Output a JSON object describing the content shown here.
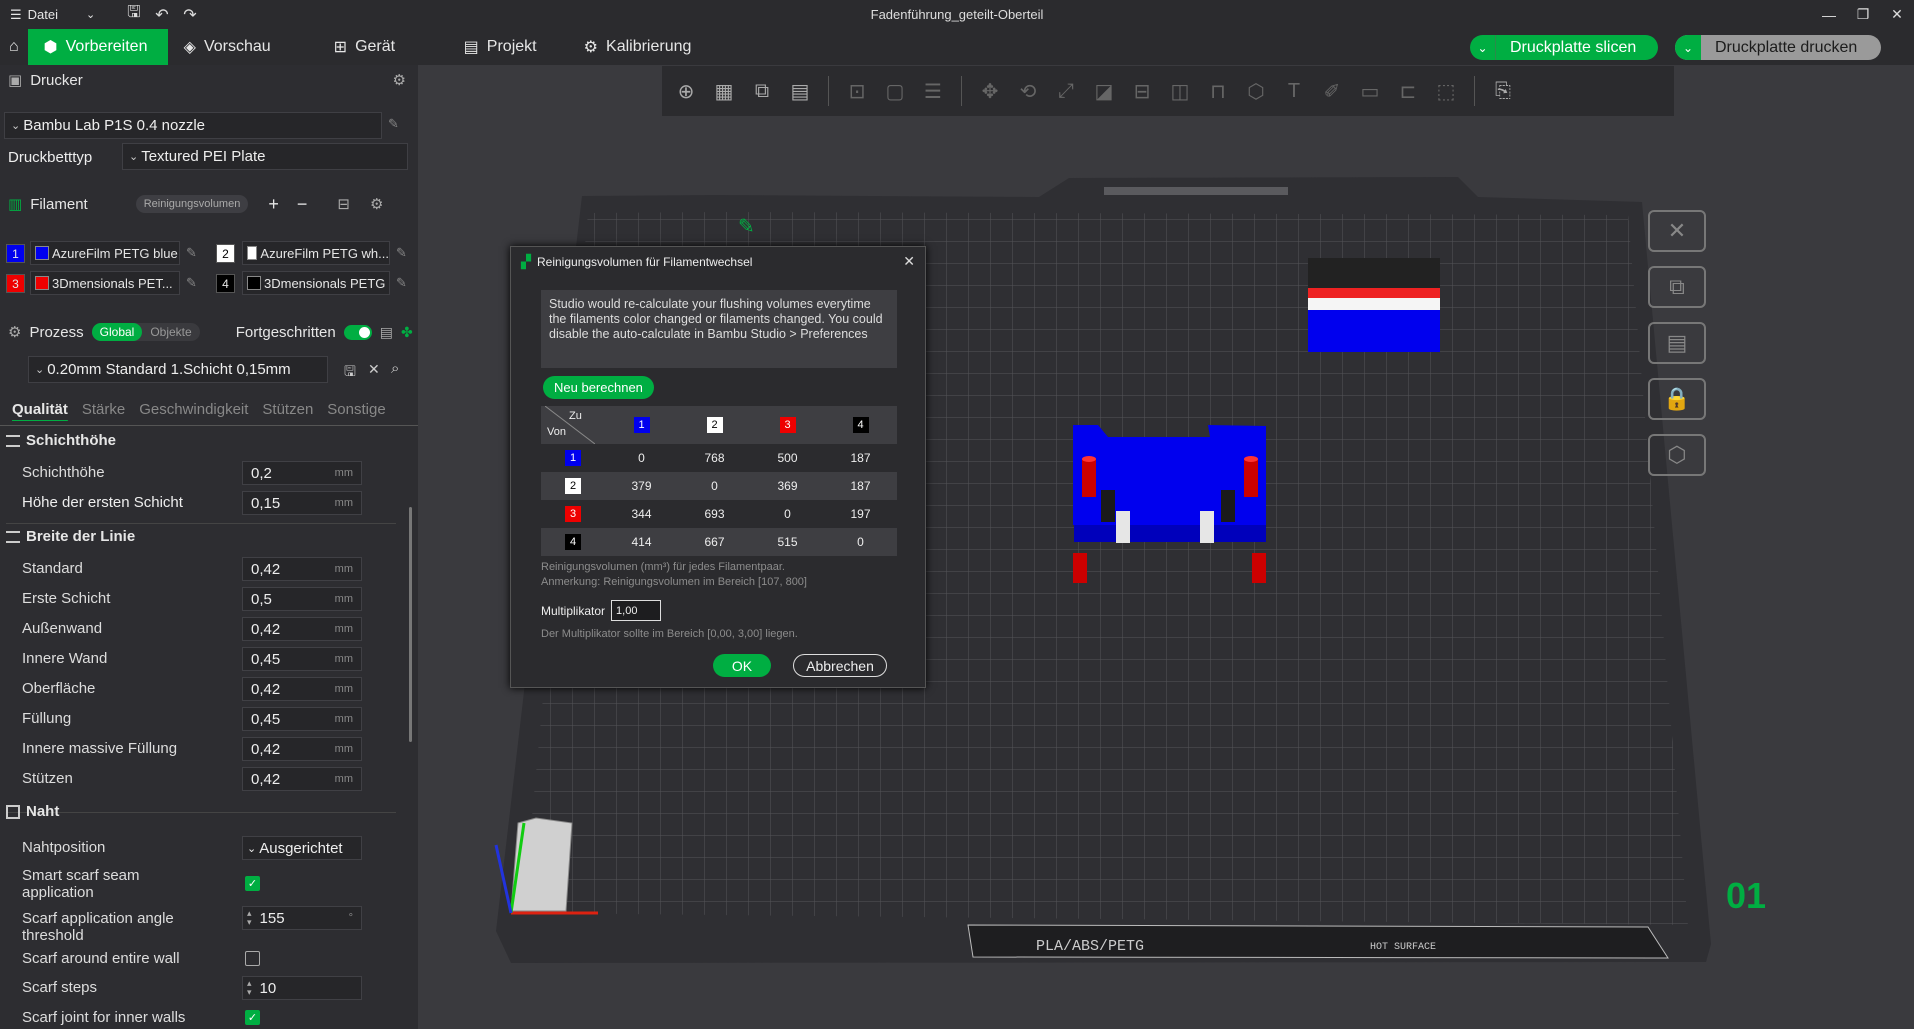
{
  "titlebar": {
    "menu_label": "Datei",
    "title": "Fadenführung_geteilt-Oberteil"
  },
  "nav": {
    "tabs": [
      "Vorbereiten",
      "Vorschau",
      "Gerät",
      "Projekt",
      "Kalibrierung"
    ],
    "slice_label": "Druckplatte slicen",
    "print_label": "Druckplatte drucken"
  },
  "sidebar": {
    "printer": {
      "heading": "Drucker",
      "name": "Bambu Lab P1S 0.4 nozzle",
      "bed_label": "Druckbetttyp",
      "bed_value": "Textured PEI Plate"
    },
    "filament": {
      "heading": "Filament",
      "flush_btn": "Reinigungsvolumen",
      "items": [
        {
          "num": "1",
          "name": "AzureFilm PETG blue",
          "color": "#0000ee"
        },
        {
          "num": "2",
          "name": "AzureFilm PETG wh...",
          "color": "#ffffff"
        },
        {
          "num": "3",
          "name": "3Dmensionals PET...",
          "color": "#ee0000"
        },
        {
          "num": "4",
          "name": "3Dmensionals PETG",
          "color": "#000000"
        }
      ]
    },
    "process": {
      "heading": "Prozess",
      "global": "Global",
      "objects": "Objekte",
      "advanced": "Fortgeschritten",
      "preset": "0.20mm Standard 1.Schicht 0,15mm"
    },
    "tabs": [
      "Qualität",
      "Stärke",
      "Geschwindigkeit",
      "Stützen",
      "Sonstige"
    ],
    "groups": {
      "layer_height": "Schichthöhe",
      "line_width": "Breite der Linie",
      "seam": "Naht"
    },
    "layer": [
      {
        "label": "Schichthöhe",
        "value": "0,2",
        "unit": "mm"
      },
      {
        "label": "Höhe der ersten Schicht",
        "value": "0,15",
        "unit": "mm"
      }
    ],
    "width": [
      {
        "label": "Standard",
        "value": "0,42",
        "unit": "mm"
      },
      {
        "label": "Erste Schicht",
        "value": "0,5",
        "unit": "mm"
      },
      {
        "label": "Außenwand",
        "value": "0,42",
        "unit": "mm"
      },
      {
        "label": "Innere Wand",
        "value": "0,45",
        "unit": "mm"
      },
      {
        "label": "Oberfläche",
        "value": "0,42",
        "unit": "mm"
      },
      {
        "label": "Füllung",
        "value": "0,45",
        "unit": "mm"
      },
      {
        "label": "Innere massive Füllung",
        "value": "0,42",
        "unit": "mm"
      },
      {
        "label": "Stützen",
        "value": "0,42",
        "unit": "mm"
      }
    ],
    "seam": {
      "position_label": "Nahtposition",
      "position_value": "Ausgerichtet",
      "smart_label": "Smart scarf seam application",
      "smart_checked": true,
      "angle_label": "Scarf application angle threshold",
      "angle_value": "155",
      "angle_unit": "°",
      "around_label": "Scarf around entire wall",
      "around_checked": false,
      "steps_label": "Scarf steps",
      "steps_value": "10",
      "inner_label": "Scarf joint for inner walls",
      "inner_checked": true
    }
  },
  "viewport": {
    "plate_number": "01",
    "plate_label": "PLA/ABS/PETG",
    "plate_surface": "HOT SURFACE"
  },
  "dialog": {
    "title": "Reinigungsvolumen für Filamentwechsel",
    "info": "Studio would re-calculate your flushing volumes everytime the filaments color changed or filaments changed. You could disable the auto-calculate in Bambu Studio > Preferences",
    "recalc": "Neu berechnen",
    "to_label": "Zu",
    "from_label": "Von",
    "columns": [
      "1",
      "2",
      "3",
      "4"
    ],
    "rows": [
      {
        "from": "1",
        "values": [
          "0",
          "768",
          "500",
          "187"
        ]
      },
      {
        "from": "2",
        "values": [
          "379",
          "0",
          "369",
          "187"
        ]
      },
      {
        "from": "3",
        "values": [
          "344",
          "693",
          "0",
          "197"
        ]
      },
      {
        "from": "4",
        "values": [
          "414",
          "667",
          "515",
          "0"
        ]
      }
    ],
    "note1": "Reinigungsvolumen (mm³) für jedes Filamentpaar.",
    "note2": "Anmerkung: Reinigungsvolumen im Bereich [107, 800]",
    "mult_label": "Multiplikator",
    "mult_value": "1,00",
    "mult_note": "Der Multiplikator sollte im Bereich [0,00, 3,00] liegen.",
    "ok": "OK",
    "cancel": "Abbrechen"
  }
}
